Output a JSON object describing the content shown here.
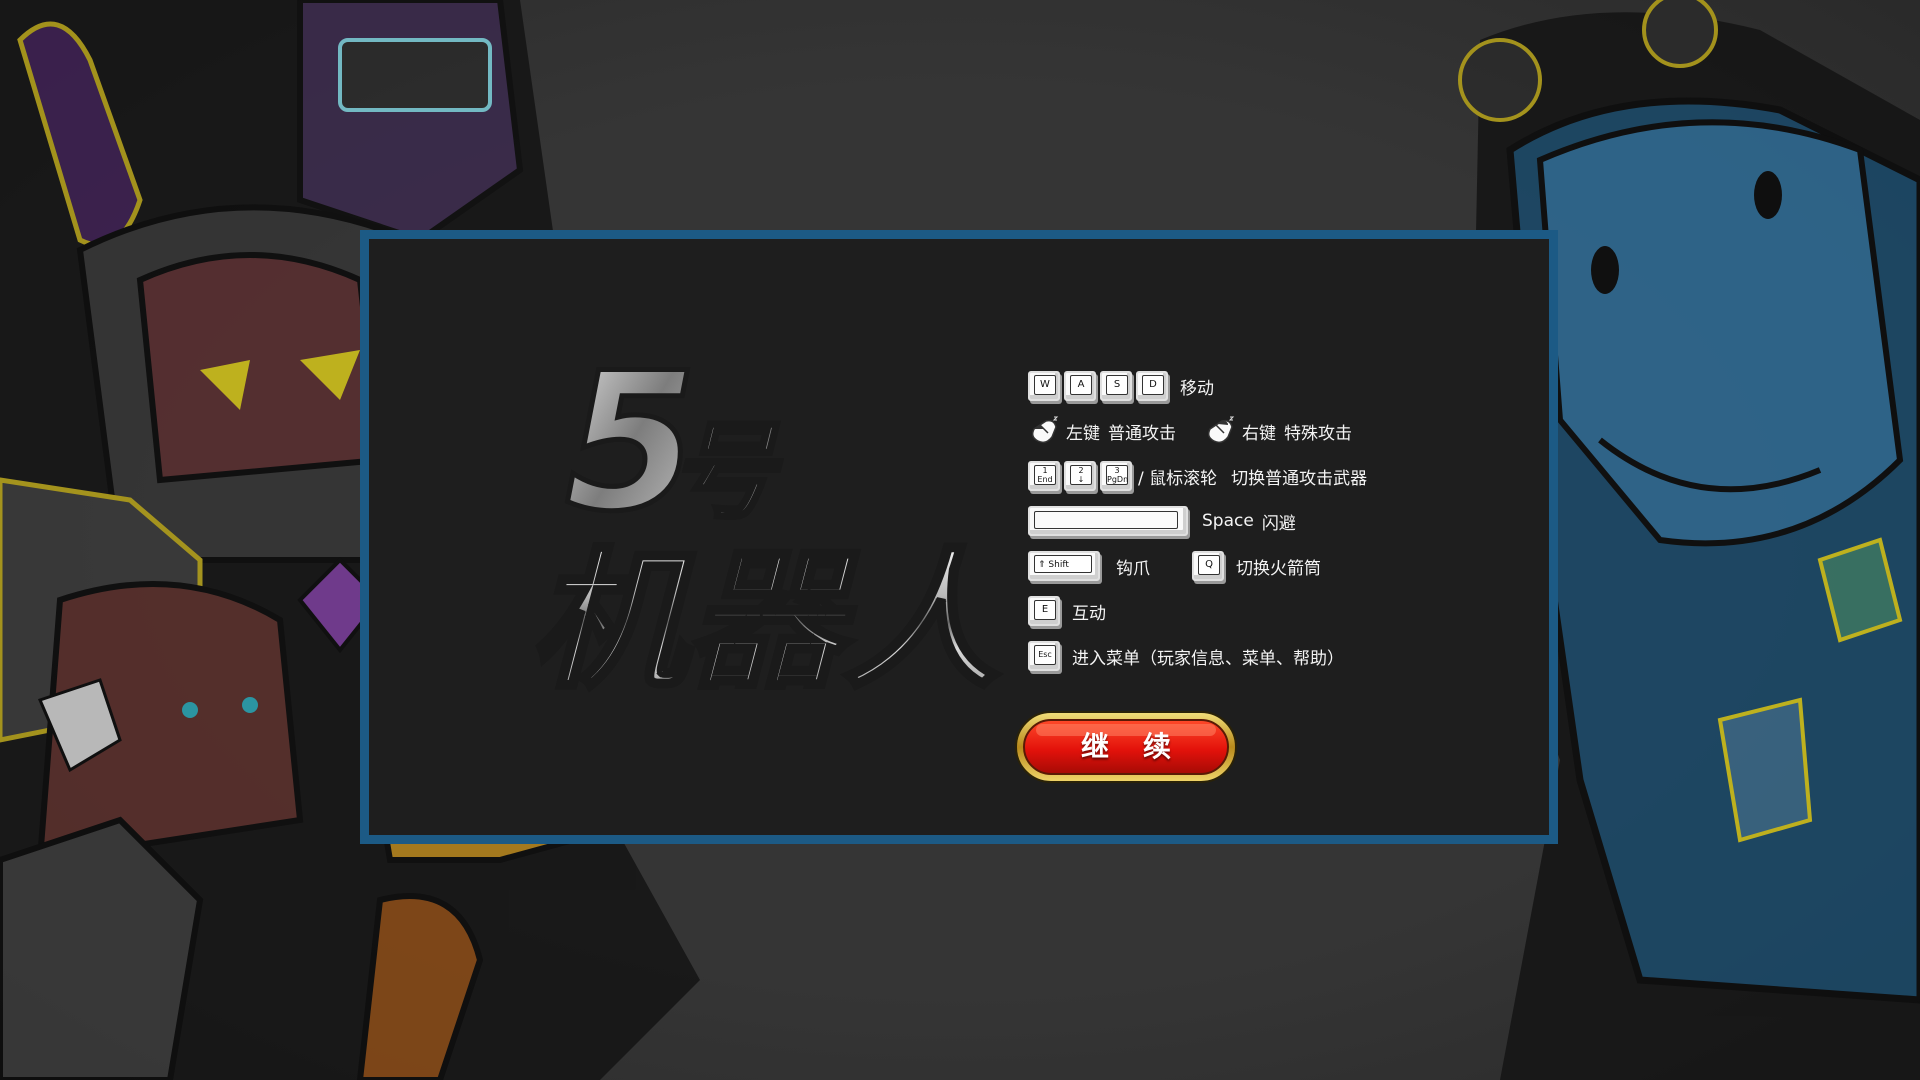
{
  "logo": {
    "number": "5",
    "hao": "号",
    "title": "机器人"
  },
  "controls": {
    "move": {
      "keys": [
        "W",
        "A",
        "S",
        "D"
      ],
      "label": "移动"
    },
    "attack": {
      "left_button": "左键",
      "left_action": "普通攻击",
      "right_button": "右键",
      "right_action": "特殊攻击"
    },
    "switch_weapon": {
      "keys": [
        {
          "top": "1",
          "sub": "End"
        },
        {
          "top": "2",
          "sub": "↓"
        },
        {
          "top": "3",
          "sub": "PgDn"
        }
      ],
      "separator": "/ 鼠标滚轮",
      "label": "切换普通攻击武器"
    },
    "dodge": {
      "key": "Space",
      "label": "闪避"
    },
    "grapple": {
      "key": "⇑ Shift",
      "label": "钩爪"
    },
    "rocket": {
      "key": "Q",
      "label": "切换火箭筒"
    },
    "interact": {
      "key": "E",
      "label": "互动"
    },
    "menu": {
      "key": "Esc",
      "label": "进入菜单（玩家信息、菜单、帮助）"
    }
  },
  "continue_button": {
    "label": "继续"
  },
  "colors": {
    "panel_border": "#1c5a85",
    "panel_bg": "#1e1e1e",
    "button_red": "#e3120b",
    "button_gold": "#d6b23a"
  }
}
